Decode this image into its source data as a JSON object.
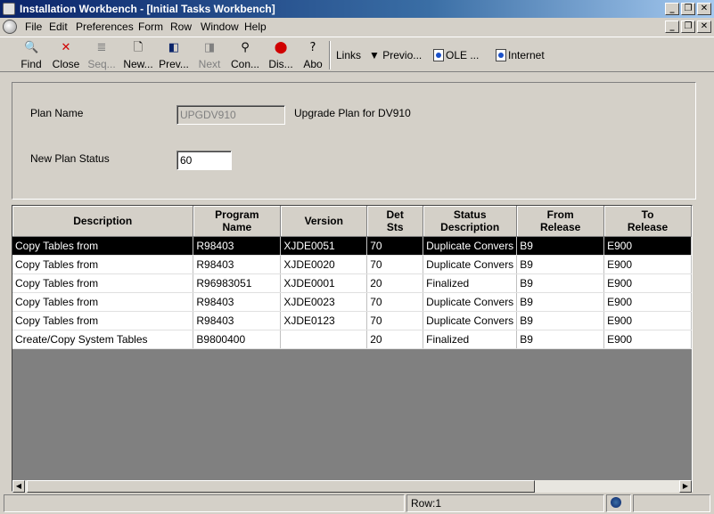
{
  "window": {
    "title": "Installation Workbench - [Initial Tasks Workbench]"
  },
  "menu": [
    "File",
    "Edit",
    "Preferences",
    "Form",
    "Row",
    "Window",
    "Help"
  ],
  "toolbar": {
    "find": "Find",
    "close": "Close",
    "seq": "Seq...",
    "new": "New...",
    "prev": "Prev...",
    "next": "Next",
    "con": "Con...",
    "dis": "Dis...",
    "abo": "Abo",
    "links": "Links",
    "previo": "Previo...",
    "ole": "OLE ...",
    "internet": "Internet"
  },
  "form": {
    "plan_name_label": "Plan Name",
    "plan_name_value": "UPGDV910",
    "plan_name_desc": "Upgrade Plan for DV910",
    "new_status_label": "New Plan Status",
    "new_status_value": "60"
  },
  "grid": {
    "headers": [
      [
        "Description"
      ],
      [
        "Program",
        "Name"
      ],
      [
        "Version"
      ],
      [
        "Det",
        "Sts"
      ],
      [
        "Status",
        "Description"
      ],
      [
        "From",
        "Release"
      ],
      [
        "To",
        "Release"
      ]
    ],
    "rows": [
      [
        "Copy Tables from",
        "R98403",
        "XJDE0051",
        "70",
        "Duplicate Convers",
        "B9",
        "E900"
      ],
      [
        "Copy Tables from",
        "R98403",
        "XJDE0020",
        "70",
        "Duplicate Convers",
        "B9",
        "E900"
      ],
      [
        "Copy Tables from",
        "R96983051",
        "XJDE0001",
        "20",
        "Finalized",
        "B9",
        "E900"
      ],
      [
        "Copy Tables from",
        "R98403",
        "XJDE0023",
        "70",
        "Duplicate Convers",
        "B9",
        "E900"
      ],
      [
        "Copy Tables from",
        "R98403",
        "XJDE0123",
        "70",
        "Duplicate Convers",
        "B9",
        "E900"
      ],
      [
        "Create/Copy System Tables",
        "B9800400",
        "",
        "20",
        "Finalized",
        "B9",
        "E900"
      ]
    ],
    "selected_row": 0
  },
  "status": {
    "row": "Row:1"
  }
}
